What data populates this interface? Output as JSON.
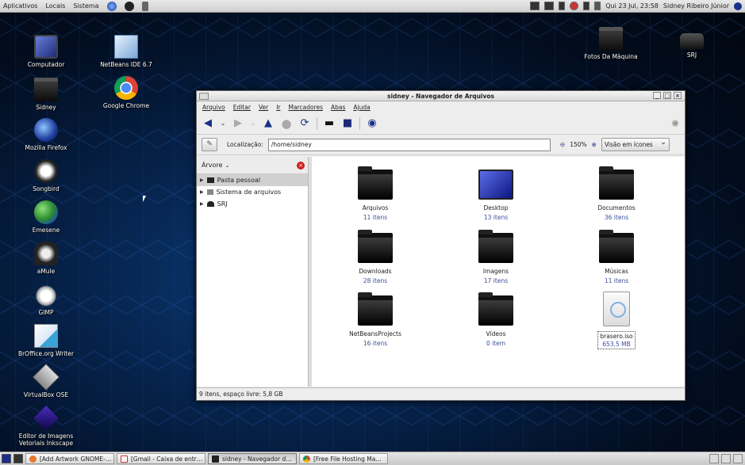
{
  "top_panel": {
    "menus": [
      "Aplicativos",
      "Locais",
      "Sistema"
    ],
    "clock": "Qui 23 Jul, 23:58",
    "user": "Sidney Ribeiro Júnior"
  },
  "desktop_left": [
    {
      "label": "Computador",
      "icon": "computer-icon"
    },
    {
      "label": "Sidney",
      "icon": "home-icon"
    },
    {
      "label": "Mozilla Firefox",
      "icon": "firefox-icon"
    },
    {
      "label": "Songbird",
      "icon": "songbird-icon"
    },
    {
      "label": "Emesene",
      "icon": "emesene-icon"
    },
    {
      "label": "aMule",
      "icon": "amule-icon"
    },
    {
      "label": "GIMP",
      "icon": "gimp-icon"
    },
    {
      "label": "BrOffice.org Writer",
      "icon": "writer-icon"
    },
    {
      "label": "VirtualBox OSE",
      "icon": "virtualbox-icon"
    },
    {
      "label": "Editor de Imagens Vetoriais Inkscape",
      "icon": "inkscape-icon"
    }
  ],
  "desktop_second": [
    {
      "label": "NetBeans IDE 6.7",
      "icon": "netbeans-icon"
    },
    {
      "label": "Google Chrome",
      "icon": "chrome-icon"
    }
  ],
  "desktop_right": [
    {
      "label": "Fotos Da Máquina",
      "icon": "folder-icon"
    },
    {
      "label": "SRJ",
      "icon": "drive-icon"
    }
  ],
  "window": {
    "title": "sidney - Navegador de Arquivos",
    "menus": [
      "Arquivo",
      "Editar",
      "Ver",
      "Ir",
      "Marcadores",
      "Abas",
      "Ajuda"
    ],
    "location_label": "Localização:",
    "location_value": "/home/sidney",
    "zoom": "150%",
    "view_mode": "Visão em ícones",
    "sidebar_mode": "Árvore",
    "tree": [
      {
        "label": "Pasta pessoal",
        "selected": true
      },
      {
        "label": "Sistema de arquivos",
        "selected": false
      },
      {
        "label": "SRJ",
        "selected": false
      }
    ],
    "files": [
      {
        "name": "Arquivos",
        "count": "11 itens",
        "kind": "folder"
      },
      {
        "name": "Desktop",
        "count": "13 itens",
        "kind": "desktop"
      },
      {
        "name": "Documentos",
        "count": "36 itens",
        "kind": "folder"
      },
      {
        "name": "Downloads",
        "count": "28 itens",
        "kind": "folder"
      },
      {
        "name": "Imagens",
        "count": "17 itens",
        "kind": "folder"
      },
      {
        "name": "Músicas",
        "count": "11 itens",
        "kind": "folder"
      },
      {
        "name": "NetBeansProjects",
        "count": "16 itens",
        "kind": "folder"
      },
      {
        "name": "Vídeos",
        "count": "0 item",
        "kind": "folder"
      },
      {
        "name": "brasero.iso",
        "count": "653,5 MB",
        "kind": "iso"
      }
    ],
    "status": "9 itens, espaço livre: 5,8 GB"
  },
  "taskbar": [
    {
      "label": "[Add Artwork GNOME-…",
      "icon": "firefox-icon",
      "active": false
    },
    {
      "label": "[Gmail - Caixa de entr…",
      "icon": "gmail-icon",
      "active": false
    },
    {
      "label": "sidney - Navegador d…",
      "icon": "folder-icon",
      "active": true
    },
    {
      "label": "[Free File Hosting Ma…",
      "icon": "chrome-icon",
      "active": false
    }
  ]
}
